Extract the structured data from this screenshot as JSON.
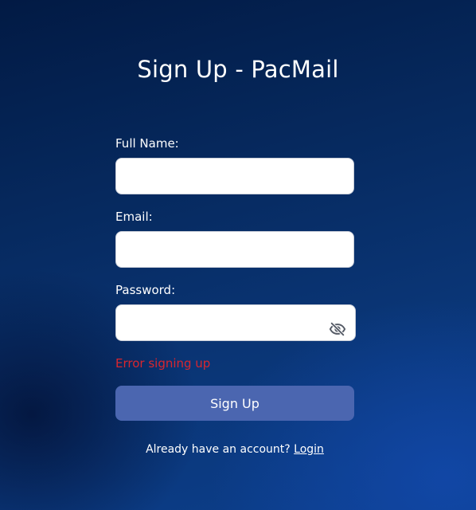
{
  "page": {
    "title": "Sign Up - PacMail"
  },
  "form": {
    "full_name": {
      "label": "Full Name:",
      "value": ""
    },
    "email": {
      "label": "Email:",
      "value": ""
    },
    "password": {
      "label": "Password:",
      "value": "",
      "toggle_icon": "eye-slash-icon"
    },
    "error_message": "Error signing up",
    "submit_label": "Sign Up"
  },
  "footer": {
    "prompt": "Already have an account?",
    "login_link": "Login"
  },
  "colors": {
    "error": "#d9262e",
    "button": "#4b66b0",
    "background": "#06295e"
  }
}
